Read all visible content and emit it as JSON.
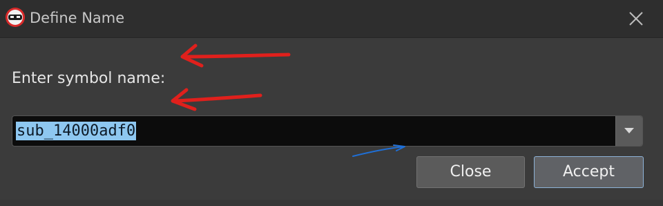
{
  "window": {
    "title": "Define Name",
    "icon": "app-logo-icon",
    "close_icon": "close-icon"
  },
  "dialog": {
    "prompt": "Enter symbol name:",
    "symbol_input": {
      "value": "sub_14000adf0",
      "selected": true,
      "dropdown_icon": "chevron-down-icon"
    }
  },
  "buttons": {
    "close_label": "Close",
    "accept_label": "Accept"
  },
  "annotations": {
    "red_arrows": 2,
    "blue_arrows": 1,
    "red_color": "#e0201c",
    "blue_color": "#1f6fd6"
  },
  "colors": {
    "titlebar": "#2e2e2e",
    "dialog_bg": "#3b3b3b",
    "input_bg": "#0c0c0c",
    "selection": "#8ec7f0",
    "accept_border": "#8eb3d8"
  }
}
